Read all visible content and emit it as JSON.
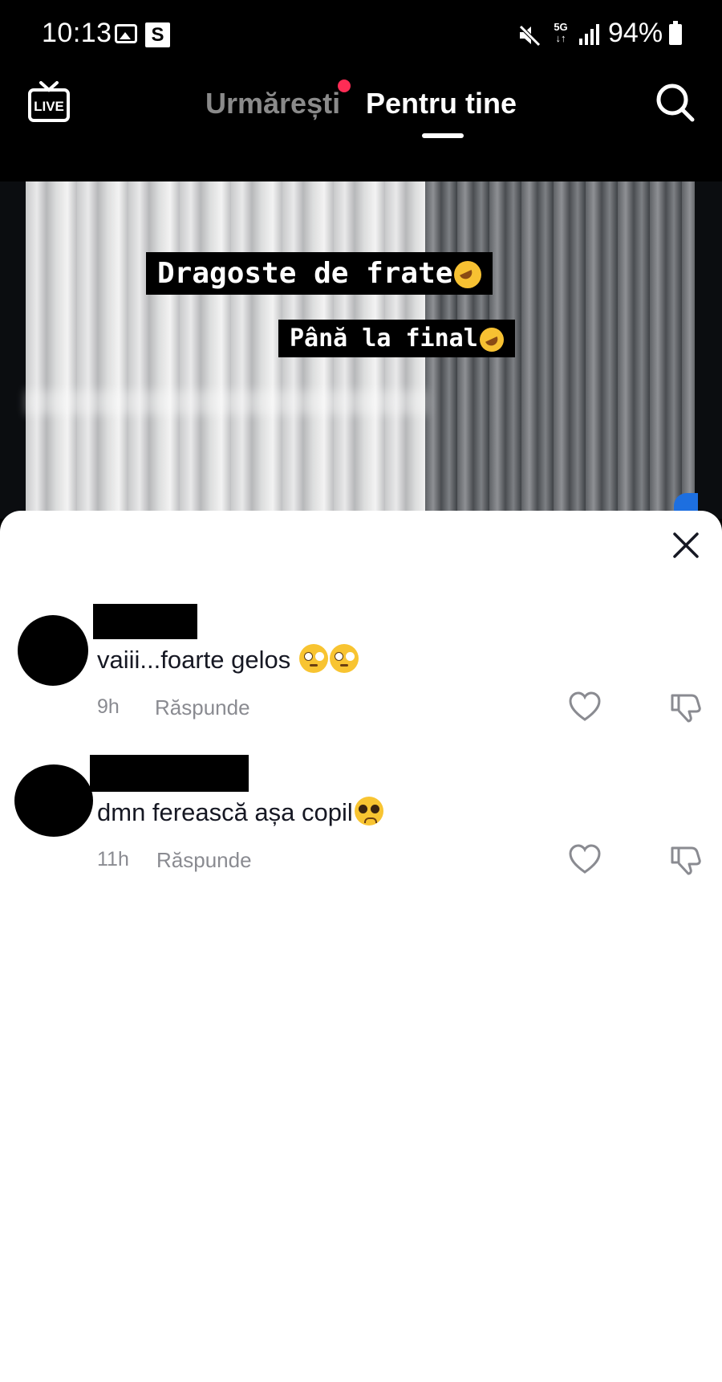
{
  "status_bar": {
    "time": "10:13",
    "notification_badge": "S",
    "network": "5G",
    "battery": "94%",
    "icons": [
      "gallery-icon",
      "mute-icon",
      "signal-icon",
      "battery-icon"
    ]
  },
  "top_nav": {
    "live_label": "LIVE",
    "tabs": [
      {
        "label": "Urmărești",
        "active": false,
        "has_dot": true
      },
      {
        "label": "Pentru tine",
        "active": true
      }
    ],
    "dot_color": "#fe2c55"
  },
  "video": {
    "captions": [
      "Dragoste de frate",
      "Până la final"
    ]
  },
  "comments": [
    {
      "text": "vaiii...foarte gelos ",
      "time": "9h",
      "reply_label": "Răspunde"
    },
    {
      "text": "dmn ferească așa copil",
      "time": "11h",
      "reply_label": "Răspunde"
    }
  ]
}
